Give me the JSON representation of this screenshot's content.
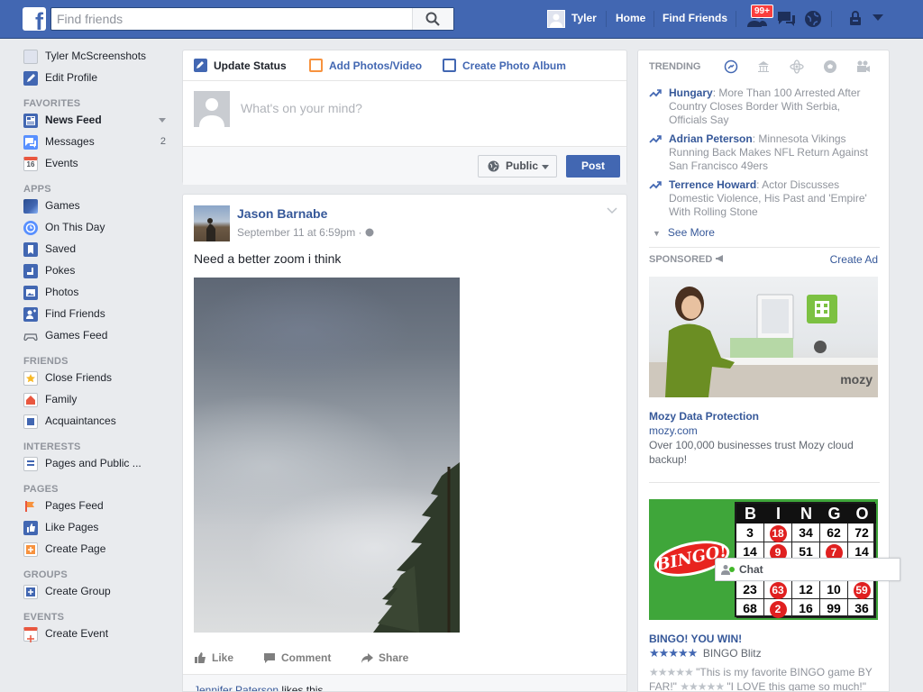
{
  "topbar": {
    "logo": "f",
    "search_placeholder": "Find friends",
    "user_name": "Tyler",
    "home": "Home",
    "find_friends": "Find Friends",
    "notif_count": "99+"
  },
  "sidebar": {
    "profile_name": "Tyler McScreenshots",
    "edit_profile": "Edit Profile",
    "favorites_head": "FAVORITES",
    "news_feed": "News Feed",
    "messages": "Messages",
    "messages_count": "2",
    "events": "Events",
    "events_icon_num": "16",
    "apps_head": "APPS",
    "games": "Games",
    "on_this_day": "On This Day",
    "saved": "Saved",
    "pokes": "Pokes",
    "photos": "Photos",
    "find_friends": "Find Friends",
    "games_feed": "Games Feed",
    "friends_head": "FRIENDS",
    "close_friends": "Close Friends",
    "family": "Family",
    "acquaintances": "Acquaintances",
    "interests_head": "INTERESTS",
    "pages_public": "Pages and Public ...",
    "pages_head": "PAGES",
    "pages_feed": "Pages Feed",
    "like_pages": "Like Pages",
    "create_page": "Create Page",
    "groups_head": "GROUPS",
    "create_group": "Create Group",
    "events_head": "EVENTS",
    "create_event": "Create Event"
  },
  "composer": {
    "tab_status": "Update Status",
    "tab_photos": "Add Photos/Video",
    "tab_album": "Create Photo Album",
    "placeholder": "What's on your mind?",
    "privacy": "Public",
    "post": "Post"
  },
  "post": {
    "author": "Jason Barnabe",
    "time": "September 11 at 6:59pm · ",
    "text": "Need a better zoom i think",
    "like": "Like",
    "comment": "Comment",
    "share": "Share",
    "liker": "Jennifer Paterson",
    "likes_suffix": " likes this."
  },
  "trending": {
    "head": "TRENDING",
    "items": [
      {
        "name": "Hungary",
        "text": ": More Than 100 Arrested After Country Closes Border With Serbia, Officials Say"
      },
      {
        "name": "Adrian Peterson",
        "text": ": Minnesota Vikings Running Back Makes NFL Return Against San Francisco 49ers"
      },
      {
        "name": "Terrence Howard",
        "text": ": Actor Discusses Domestic Violence, His Past and 'Empire' With Rolling Stone"
      }
    ],
    "see_more": "See More"
  },
  "sponsored": {
    "head": "SPONSORED",
    "create_ad": "Create Ad",
    "ad1": {
      "title": "Mozy Data Protection",
      "url": "mozy.com",
      "desc": "Over 100,000 businesses trust Mozy cloud backup!",
      "brand": "mozy"
    },
    "ad2": {
      "title": "BINGO! YOU WIN!",
      "source": "BINGO Blitz",
      "logo_text": "BINGO!",
      "review1": "\"This is my favorite BINGO game BY FAR!\"",
      "review2": "\"I LOVE this game so much!\"",
      "rating": 4.5,
      "grid_head": [
        "B",
        "I",
        "N",
        "G",
        "O"
      ],
      "grid_rows": [
        [
          "3",
          "18",
          "34",
          "62",
          "72"
        ],
        [
          "14",
          "9",
          "51",
          "7",
          "14"
        ],
        [
          "",
          "",
          "",
          "",
          ""
        ],
        [
          "23",
          "63",
          "12",
          "10",
          "59"
        ],
        [
          "68",
          "2",
          "16",
          "99",
          "36"
        ]
      ],
      "marked": [
        "18",
        "9",
        "7",
        "63",
        "59",
        "2"
      ]
    }
  },
  "chat": {
    "label": "Chat"
  },
  "colors": {
    "brand": "#4267b2",
    "link": "#365899",
    "badge": "#fa3e3e"
  }
}
